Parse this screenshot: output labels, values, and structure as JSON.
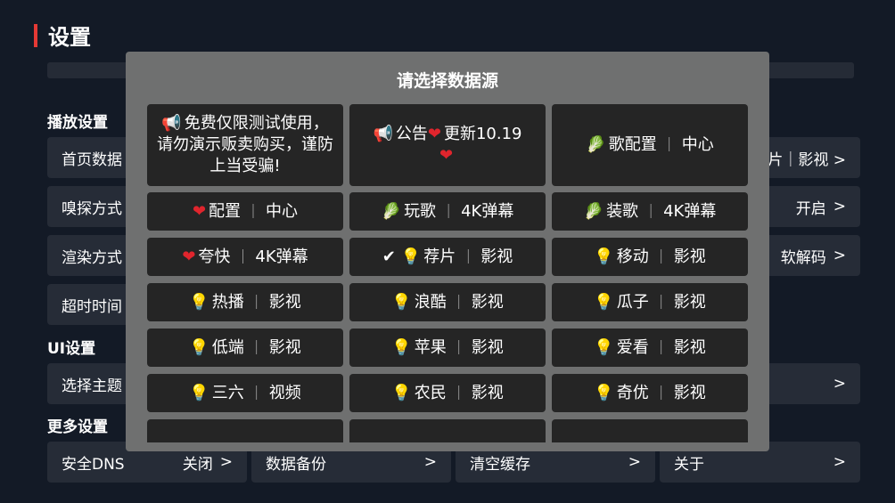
{
  "page": {
    "title": "设置"
  },
  "sections": {
    "playback": "播放设置",
    "ui": "UI设置",
    "more": "更多设置"
  },
  "rows": {
    "home_source": {
      "label": "首页数据",
      "value": "荐片｜影视 >"
    },
    "sniff": {
      "label": "嗅探方式",
      "value": "开启",
      "arrow": ">"
    },
    "render": {
      "label": "渲染方式",
      "value": "软解码",
      "arrow": ">"
    },
    "timeout": {
      "label": "超时时间"
    },
    "theme": {
      "label": "选择主题",
      "arrow": ">"
    },
    "dns": {
      "label": "安全DNS",
      "value": "关闭",
      "arrow": ">"
    },
    "backup": {
      "label": "数据备份",
      "arrow": ">"
    },
    "cache": {
      "label": "清空缓存",
      "arrow": ">"
    },
    "about": {
      "label": "关于",
      "arrow": ">"
    }
  },
  "dialog": {
    "title": "请选择数据源",
    "items": [
      {
        "icon": "📢",
        "text": "免费仅限测试使用，请勿演示贩卖购买，谨防上当受骗!"
      },
      {
        "icon": "📢",
        "text": "公告",
        "icon2": "❤",
        "text2": "更新10.19",
        "icon3": "❤"
      },
      {
        "icon": "🥬",
        "name": "歌配置",
        "kind": "中心"
      },
      {
        "icon": "❤",
        "name": "配置",
        "kind": "中心"
      },
      {
        "icon": "🥬",
        "name": "玩歌",
        "kind": "4K弹幕"
      },
      {
        "icon": "🥬",
        "name": "装歌",
        "kind": "4K弹幕"
      },
      {
        "icon": "❤",
        "name": "夸快",
        "kind": "4K弹幕"
      },
      {
        "check": "✔",
        "icon": "💡",
        "name": "荐片",
        "kind": "影视"
      },
      {
        "icon": "💡",
        "name": "移动",
        "kind": "影视"
      },
      {
        "icon": "💡",
        "name": "热播",
        "kind": "影视"
      },
      {
        "icon": "💡",
        "name": "浪酷",
        "kind": "影视"
      },
      {
        "icon": "💡",
        "name": "瓜子",
        "kind": "影视"
      },
      {
        "icon": "💡",
        "name": "低端",
        "kind": "影视"
      },
      {
        "icon": "💡",
        "name": "苹果",
        "kind": "影视"
      },
      {
        "icon": "💡",
        "name": "爱看",
        "kind": "影视"
      },
      {
        "icon": "💡",
        "name": "三六",
        "kind": "视频"
      },
      {
        "icon": "💡",
        "name": "农民",
        "kind": "影视"
      },
      {
        "icon": "💡",
        "name": "奇优",
        "kind": "影视"
      }
    ]
  },
  "separator": "｜",
  "colors": {
    "accent": "#e53935",
    "background": "#131a26",
    "dialog": "#6f7070",
    "cell": "#252525"
  }
}
